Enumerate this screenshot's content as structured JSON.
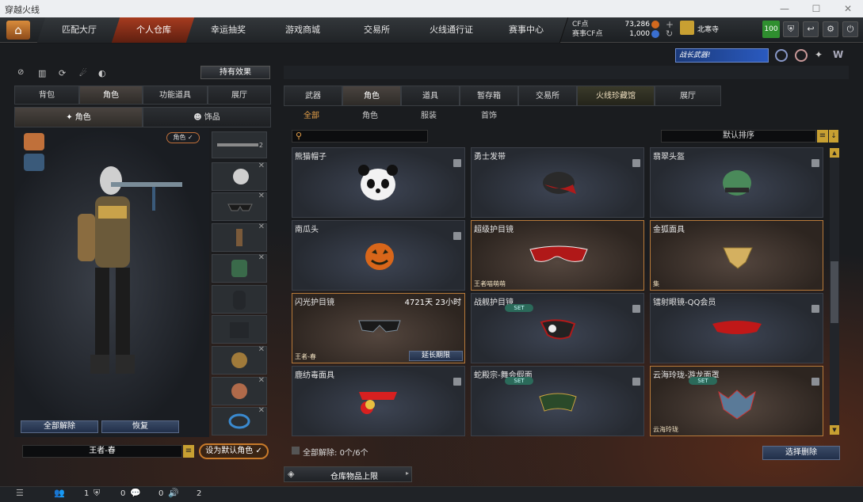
{
  "window": {
    "title": "穿越火线",
    "min": "—",
    "max": "☐",
    "close": "✕"
  },
  "nav": {
    "tabs": [
      "匹配大厅",
      "个人仓库",
      "幸运抽奖",
      "游戏商城",
      "交易所",
      "火线通行证",
      "赛事中心"
    ],
    "active": 1
  },
  "currency": {
    "cf_label": "CF点",
    "cf_value": "73,286",
    "match_label": "赛事CF点",
    "match_value": "1,000"
  },
  "user": {
    "name": "北寒寺",
    "level": "100"
  },
  "banner": {
    "text": "战长武器!"
  },
  "left": {
    "effects_btn": "持有效果",
    "tabs": [
      "背包",
      "角色",
      "功能道具",
      "展厅"
    ],
    "active_tab": 1,
    "subtabs": [
      "角色",
      "饰品"
    ],
    "role_badge": "角色",
    "release_all": "全部解除",
    "restore": "恢复",
    "char_name": "王者-春",
    "default_btn": "设为默认角色"
  },
  "right": {
    "tabs": [
      "武器",
      "角色",
      "道具",
      "暂存箱",
      "交易所",
      "火线珍藏馆",
      "展厅"
    ],
    "active_tab": 1,
    "highlight_tab": 5,
    "subtabs": [
      "全部",
      "角色",
      "服装",
      "首饰"
    ],
    "active_sub": 0,
    "search": {
      "placeholder": ""
    },
    "sort": "默认排序",
    "items": [
      {
        "name": "熊猫帽子",
        "icon": "panda-hat-icon"
      },
      {
        "name": "勇士发带",
        "icon": "headband-icon"
      },
      {
        "name": "翡翠头盔",
        "icon": "jade-helmet-icon"
      },
      {
        "name": "南瓜头",
        "icon": "pumpkin-head-icon"
      },
      {
        "name": "超级护目镜",
        "tag": "王者喵萌萌",
        "icon": "super-goggles-icon"
      },
      {
        "name": "金狐面具",
        "tag": "集",
        "icon": "fox-mask-icon"
      },
      {
        "name": "闪光护目镜",
        "time": "4721天 23小时",
        "tag": "王者-春",
        "btn": "延长期限",
        "icon": "flash-goggles-icon"
      },
      {
        "name": "战舰护目镜",
        "set": "SET",
        "icon": "warship-goggles-icon"
      },
      {
        "name": "镭射眼镜-QQ会员",
        "icon": "laser-glasses-icon"
      },
      {
        "name": "鹿纺毒面具",
        "icon": "gas-mask-icon"
      },
      {
        "name": "蛇殿宗-舞会假面",
        "set": "SET",
        "icon": "masquerade-mask-icon"
      },
      {
        "name": "云海玲珑-游龙面罩",
        "set": "SET",
        "tag": "云海玲珑",
        "icon": "dragon-mask-icon"
      }
    ],
    "release_all": "全部解除:",
    "release_count": "0个/6个",
    "select_delete": "选择删除",
    "capacity": "仓库物品上限"
  },
  "bottom": {
    "counts": [
      "1",
      "0",
      "0",
      "2"
    ]
  },
  "colors": {
    "accent": "#e8a24a",
    "active_nav": "#a63b1f",
    "gold_border": "#b87a3a"
  }
}
